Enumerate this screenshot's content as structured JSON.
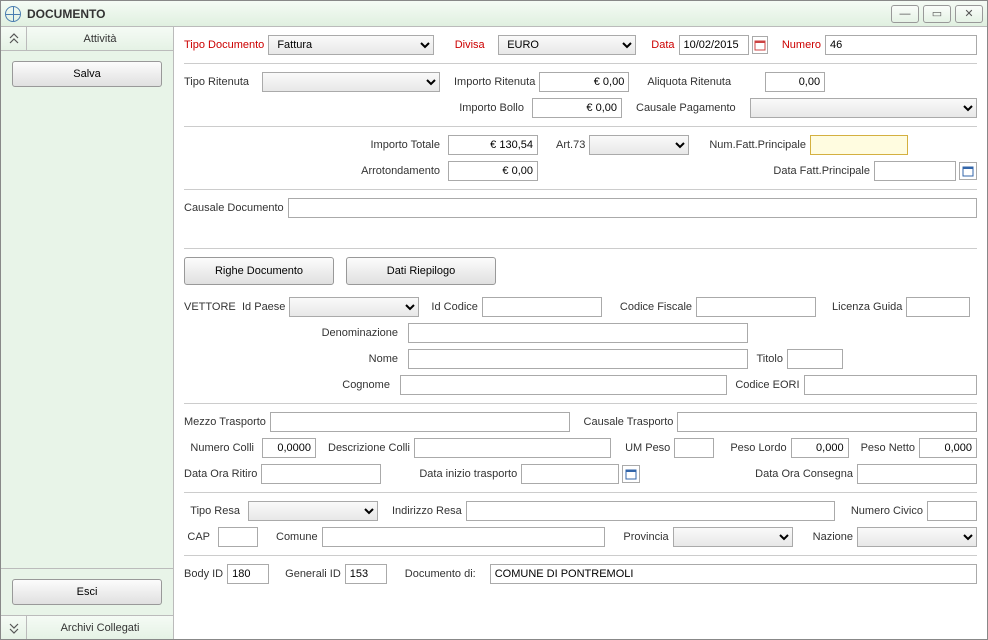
{
  "window": {
    "title": "DOCUMENTO"
  },
  "sidebar": {
    "attivita": "Attività",
    "salva": "Salva",
    "esci": "Esci",
    "archivi": "Archivi Collegati"
  },
  "labels": {
    "tipoDocumento": "Tipo Documento",
    "divisa": "Divisa",
    "data": "Data",
    "numero": "Numero",
    "tipoRitenuta": "Tipo Ritenuta",
    "importoRitenuta": "Importo Ritenuta",
    "aliquotaRitenuta": "Aliquota Ritenuta",
    "importoBollo": "Importo Bollo",
    "causalePagamento": "Causale Pagamento",
    "importoTotale": "Importo Totale",
    "art73": "Art.73",
    "numFattPrincipale": "Num.Fatt.Principale",
    "arrotondamento": "Arrotondamento",
    "dataFattPrincipale": "Data Fatt.Principale",
    "causaleDocumento": "Causale Documento",
    "righeDocumento": "Righe Documento",
    "datiRiepilogo": "Dati Riepilogo",
    "vettore": "VETTORE",
    "idPaese": "Id Paese",
    "idCodice": "Id Codice",
    "codiceFiscale": "Codice Fiscale",
    "licenzaGuida": "Licenza Guida",
    "denominazione": "Denominazione",
    "nome": "Nome",
    "titolo": "Titolo",
    "cognome": "Cognome",
    "codiceEori": "Codice EORI",
    "mezzoTrasporto": "Mezzo Trasporto",
    "causaleTrasporto": "Causale Trasporto",
    "numeroColli": "Numero Colli",
    "descrizioneColli": "Descrizione Colli",
    "umPeso": "UM Peso",
    "pesoLordo": "Peso Lordo",
    "pesoNetto": "Peso Netto",
    "dataOraRitiro": "Data Ora Ritiro",
    "dataInizioTrasporto": "Data inizio trasporto",
    "dataOraConsegna": "Data Ora Consegna",
    "tipoResa": "Tipo Resa",
    "indirizzoResa": "Indirizzo Resa",
    "numeroCivico": "Numero Civico",
    "cap": "CAP",
    "comune": "Comune",
    "provincia": "Provincia",
    "nazione": "Nazione",
    "bodyId": "Body ID",
    "generaliId": "Generali ID",
    "documentoDi": "Documento di:"
  },
  "values": {
    "tipoDocumento": "Fattura",
    "divisa": "EURO",
    "data": "10/02/2015",
    "numero": "46",
    "importoRitenuta": "€ 0,00",
    "aliquotaRitenuta": "0,00",
    "importoBollo": "€ 0,00",
    "importoTotale": "€ 130,54",
    "arrotondamento": "€ 0,00",
    "numeroColli": "0,0000",
    "pesoLordo": "0,000",
    "pesoNetto": "0,000",
    "bodyId": "180",
    "generaliId": "153",
    "documentoDi": "COMUNE DI PONTREMOLI"
  }
}
